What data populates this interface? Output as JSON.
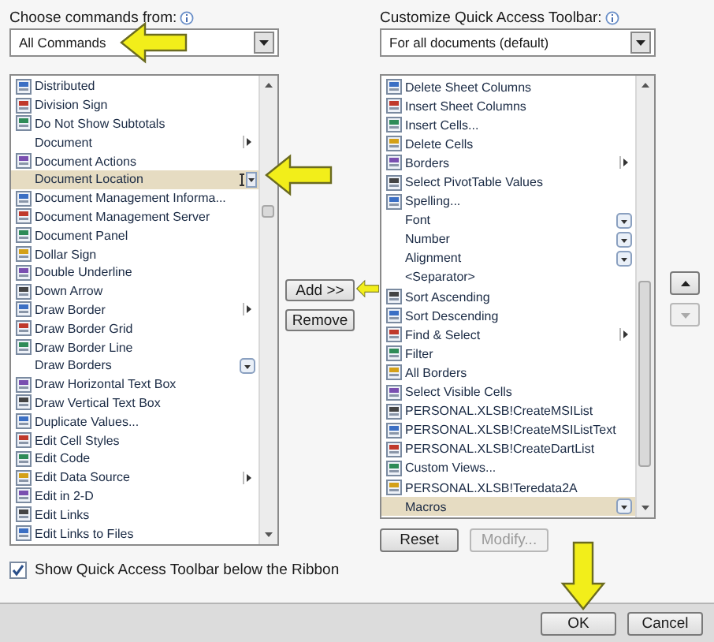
{
  "left": {
    "label": "Choose commands from:",
    "combo": {
      "value": "All Commands"
    },
    "items": [
      {
        "label": "Distributed",
        "icon": true,
        "selected": false,
        "kind": "plain"
      },
      {
        "label": "Division Sign",
        "icon": true,
        "selected": false,
        "kind": "plain"
      },
      {
        "label": "Do Not Show Subtotals",
        "icon": true,
        "selected": false,
        "kind": "plain"
      },
      {
        "label": "Document",
        "icon": false,
        "selected": false,
        "kind": "submenu"
      },
      {
        "label": "Document Actions",
        "icon": true,
        "selected": false,
        "kind": "plain"
      },
      {
        "label": "Document Location",
        "icon": false,
        "selected": true,
        "kind": "split"
      },
      {
        "label": "Document Management Informa...",
        "icon": true,
        "selected": false,
        "kind": "plain"
      },
      {
        "label": "Document Management Server",
        "icon": true,
        "selected": false,
        "kind": "plain"
      },
      {
        "label": "Document Panel",
        "icon": true,
        "selected": false,
        "kind": "plain"
      },
      {
        "label": "Dollar Sign",
        "icon": true,
        "selected": false,
        "kind": "plain"
      },
      {
        "label": "Double Underline",
        "icon": true,
        "selected": false,
        "kind": "plain"
      },
      {
        "label": "Down Arrow",
        "icon": true,
        "selected": false,
        "kind": "plain"
      },
      {
        "label": "Draw Border",
        "icon": true,
        "selected": false,
        "kind": "submenu"
      },
      {
        "label": "Draw Border Grid",
        "icon": true,
        "selected": false,
        "kind": "plain"
      },
      {
        "label": "Draw Border Line",
        "icon": true,
        "selected": false,
        "kind": "plain"
      },
      {
        "label": "Draw Borders",
        "icon": false,
        "selected": false,
        "kind": "gallery"
      },
      {
        "label": "Draw Horizontal Text Box",
        "icon": true,
        "selected": false,
        "kind": "plain"
      },
      {
        "label": "Draw Vertical Text Box",
        "icon": true,
        "selected": false,
        "kind": "plain"
      },
      {
        "label": "Duplicate Values...",
        "icon": true,
        "selected": false,
        "kind": "plain"
      },
      {
        "label": "Edit Cell Styles",
        "icon": true,
        "selected": false,
        "kind": "plain"
      },
      {
        "label": "Edit Code",
        "icon": true,
        "selected": false,
        "kind": "plain"
      },
      {
        "label": "Edit Data Source",
        "icon": true,
        "selected": false,
        "kind": "submenu"
      },
      {
        "label": "Edit in 2-D",
        "icon": true,
        "selected": false,
        "kind": "plain"
      },
      {
        "label": "Edit Links",
        "icon": true,
        "selected": false,
        "kind": "plain"
      },
      {
        "label": "Edit Links to Files",
        "icon": true,
        "selected": false,
        "kind": "plain"
      }
    ],
    "checkbox": {
      "label": "Show Quick Access Toolbar below the Ribbon",
      "checked": true
    }
  },
  "middle": {
    "buttons": [
      {
        "label": "Add >>",
        "disabled": false
      },
      {
        "label": "Remove",
        "disabled": false
      }
    ]
  },
  "right": {
    "label": "Customize Quick Access Toolbar:",
    "combo": {
      "value": "For all documents (default)"
    },
    "items": [
      {
        "label": "Delete Sheet Columns",
        "icon": true,
        "selected": false,
        "kind": "plain"
      },
      {
        "label": "Insert Sheet Columns",
        "icon": true,
        "selected": false,
        "kind": "plain"
      },
      {
        "label": "Insert Cells...",
        "icon": true,
        "selected": false,
        "kind": "plain"
      },
      {
        "label": "Delete Cells",
        "icon": true,
        "selected": false,
        "kind": "plain"
      },
      {
        "label": "Borders",
        "icon": true,
        "selected": false,
        "kind": "submenu"
      },
      {
        "label": "Select PivotTable Values",
        "icon": true,
        "selected": false,
        "kind": "plain"
      },
      {
        "label": "Spelling...",
        "icon": true,
        "selected": false,
        "kind": "plain"
      },
      {
        "label": "Font",
        "icon": false,
        "selected": false,
        "kind": "gallery"
      },
      {
        "label": "Number",
        "icon": false,
        "selected": false,
        "kind": "gallery"
      },
      {
        "label": "Alignment",
        "icon": false,
        "selected": false,
        "kind": "gallery"
      },
      {
        "label": "<Separator>",
        "icon": false,
        "selected": false,
        "kind": "plain"
      },
      {
        "label": "Sort Ascending",
        "icon": true,
        "selected": false,
        "kind": "plain"
      },
      {
        "label": "Sort Descending",
        "icon": true,
        "selected": false,
        "kind": "plain"
      },
      {
        "label": "Find & Select",
        "icon": true,
        "selected": false,
        "kind": "submenu"
      },
      {
        "label": "Filter",
        "icon": true,
        "selected": false,
        "kind": "plain"
      },
      {
        "label": "All Borders",
        "icon": true,
        "selected": false,
        "kind": "plain"
      },
      {
        "label": "Select Visible Cells",
        "icon": true,
        "selected": false,
        "kind": "plain"
      },
      {
        "label": "PERSONAL.XLSB!CreateMSIList",
        "icon": true,
        "selected": false,
        "kind": "plain"
      },
      {
        "label": "PERSONAL.XLSB!CreateMSIListText",
        "icon": true,
        "selected": false,
        "kind": "plain"
      },
      {
        "label": "PERSONAL.XLSB!CreateDartList",
        "icon": true,
        "selected": false,
        "kind": "plain"
      },
      {
        "label": "Custom Views...",
        "icon": true,
        "selected": false,
        "kind": "plain"
      },
      {
        "label": "PERSONAL.XLSB!Teredata2A",
        "icon": true,
        "selected": false,
        "kind": "plain"
      },
      {
        "label": "Macros",
        "icon": false,
        "selected": true,
        "kind": "gallery"
      }
    ],
    "buttons": [
      {
        "label": "Reset",
        "disabled": false
      },
      {
        "label": "Modify...",
        "disabled": true
      }
    ],
    "move_up": {
      "disabled": false
    },
    "move_down": {
      "disabled": true
    }
  },
  "footer": {
    "buttons": [
      {
        "label": "OK",
        "disabled": false
      },
      {
        "label": "Cancel",
        "disabled": false
      }
    ]
  }
}
